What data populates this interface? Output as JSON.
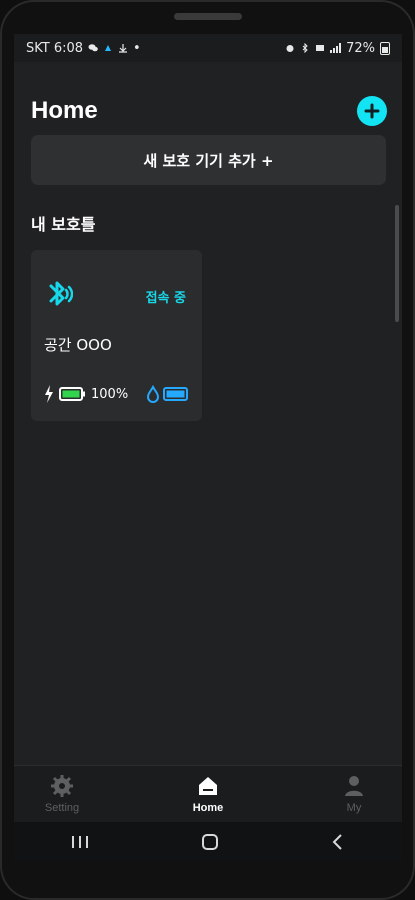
{
  "status_bar": {
    "carrier_time": "SKT 6:08",
    "battery_percent": "72%"
  },
  "header": {
    "title": "Home"
  },
  "add_device": {
    "label": "새 보호 기기 추가 +"
  },
  "section": {
    "title": "내 보호틀"
  },
  "device": {
    "status": "접속 중",
    "name": "공간 OOO",
    "battery": "100%",
    "battery_level": 1.0,
    "water_level": 1.0
  },
  "bottom_nav": {
    "setting": "Setting",
    "home": "Home",
    "my": "My"
  },
  "colors": {
    "accent": "#12e4f4",
    "battery_green": "#32d34d",
    "water_blue": "#25a8ff"
  }
}
